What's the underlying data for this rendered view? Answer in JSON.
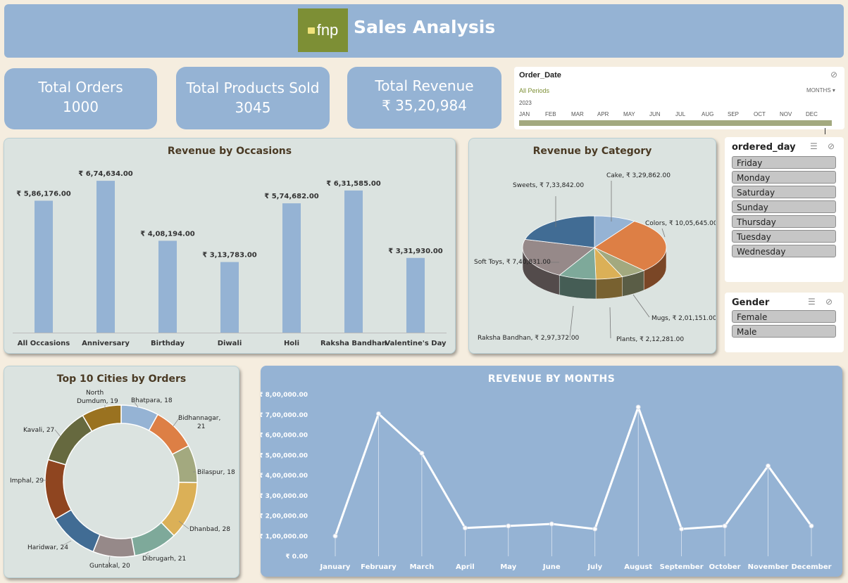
{
  "header": {
    "logo_text": "fnp",
    "title": "Sales Analysis"
  },
  "kpis": [
    {
      "label": "Total Orders",
      "value": "1000"
    },
    {
      "label": "Total Products Sold",
      "value": "3045"
    },
    {
      "label": "Total Revenue",
      "value": "₹ 35,20,984"
    }
  ],
  "timeline": {
    "field": "Order_Date",
    "period_label": "All Periods",
    "level": "MONTHS",
    "year": "2023",
    "months": [
      "JAN",
      "FEB",
      "MAR",
      "APR",
      "MAY",
      "JUN",
      "JUL",
      "AUG",
      "SEP",
      "OCT",
      "NOV",
      "DEC"
    ]
  },
  "slicers": {
    "day": {
      "title": "ordered_day",
      "items": [
        "Friday",
        "Monday",
        "Saturday",
        "Sunday",
        "Thursday",
        "Tuesday",
        "Wednesday"
      ]
    },
    "gender": {
      "title": "Gender",
      "items": [
        "Female",
        "Male"
      ]
    }
  },
  "colors": {
    "bar": "#95b3d4",
    "header": "#95b3d4",
    "line": "#ffffff",
    "logo": "#7d8f35"
  },
  "chart_data": [
    {
      "type": "bar",
      "title": "Revenue by Occasions",
      "categories": [
        "All Occasions",
        "Anniversary",
        "Birthday",
        "Diwali",
        "Holi",
        "Raksha Bandhan",
        "Valentine's Day"
      ],
      "values": [
        586176,
        674634,
        408194,
        313783,
        574682,
        631585,
        331930
      ],
      "labels": [
        "₹ 5,86,176.00",
        "₹ 6,74,634.00",
        "₹ 4,08,194.00",
        "₹ 3,13,783.00",
        "₹ 5,74,682.00",
        "₹ 6,31,585.00",
        "₹ 3,31,930.00"
      ],
      "grid": false
    },
    {
      "type": "pie",
      "title": "Revenue by Category",
      "categories": [
        "Cake",
        "Colors",
        "Mugs",
        "Plants",
        "Raksha Bandhan",
        "Soft Toys",
        "Sweets"
      ],
      "values": [
        329862,
        1005645,
        201151,
        212281,
        297372,
        740831,
        733842
      ],
      "labels": [
        "Cake, ₹ 3,29,862.00",
        "Colors, ₹ 10,05,645.00",
        "Mugs, ₹ 2,01,151.00",
        "Plants, ₹ 2,12,281.00",
        "Raksha Bandhan, ₹ 2,97,372.00",
        "Soft Toys, ₹ 7,40,831.00",
        "Sweets, ₹ 7,33,842.00"
      ],
      "colors": [
        "#95b3d4",
        "#dd7f45",
        "#a3a97f",
        "#dbb057",
        "#7ea99a",
        "#968989",
        "#416c94"
      ]
    },
    {
      "type": "pie",
      "title": "Top 10 Cities by Orders",
      "categories": [
        "Bhatpara",
        "Bidhannagar",
        "Bilaspur",
        "Dhanbad",
        "Dibrugarh",
        "Guntakal",
        "Haridwar",
        "Imphal",
        "Kavali",
        "North Dumdum"
      ],
      "values": [
        18,
        21,
        18,
        28,
        21,
        20,
        24,
        29,
        27,
        19
      ],
      "labels": [
        "Bhatpara, 18",
        "Bidhannagar, 21",
        "Bilaspur, 18",
        "Dhanbad, 28",
        "Dibrugarh, 21",
        "Guntakal, 20",
        "Haridwar, 24",
        "Imphal, 29",
        "Kavali, 27",
        "North Dumdum, 19"
      ],
      "colors": [
        "#95b3d4",
        "#dd7f45",
        "#a3a97f",
        "#dbb057",
        "#7ea99a",
        "#968989",
        "#416c94",
        "#8f4520",
        "#66693f",
        "#9a7220"
      ]
    },
    {
      "type": "line",
      "title": "REVENUE BY MONTHS",
      "categories": [
        "January",
        "February",
        "March",
        "April",
        "May",
        "June",
        "July",
        "August",
        "September",
        "October",
        "November",
        "December"
      ],
      "values": [
        100000,
        705000,
        510000,
        140000,
        150000,
        160000,
        135000,
        738000,
        135000,
        150000,
        447000,
        150000
      ],
      "ylim": [
        0,
        800000
      ],
      "yticks": [
        "₹ 0.00",
        "₹ 1,00,000.00",
        "₹ 2,00,000.00",
        "₹ 3,00,000.00",
        "₹ 4,00,000.00",
        "₹ 5,00,000.00",
        "₹ 6,00,000.00",
        "₹ 7,00,000.00",
        "₹ 8,00,000.00"
      ]
    }
  ]
}
